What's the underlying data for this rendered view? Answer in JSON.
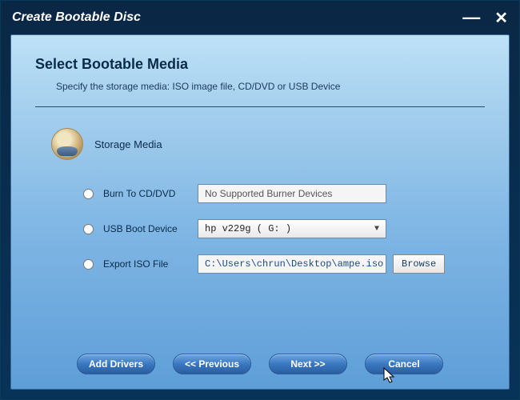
{
  "window": {
    "title": "Create Bootable Disc"
  },
  "heading": "Select Bootable Media",
  "subheading": "Specify the storage media: ISO image file, CD/DVD or USB Device",
  "section_label": "Storage Media",
  "options": {
    "burn": {
      "label": "Burn To CD/DVD",
      "value": "No Supported Burner Devices",
      "selected": false
    },
    "usb": {
      "label": "USB Boot Device",
      "value": "hp    v229g       ( G: )",
      "selected": false
    },
    "iso": {
      "label": "Export ISO File",
      "value": "C:\\Users\\chrun\\Desktop\\ampe.iso",
      "selected": false,
      "browse_label": "Browse"
    }
  },
  "buttons": {
    "add_drivers": "Add Drivers",
    "previous": "<<  Previous",
    "next": "Next  >>",
    "cancel": "Cancel"
  },
  "colors": {
    "titlebar_bg": "#0a2845",
    "panel_top": "#bde1f7",
    "panel_bottom": "#5e9ed8",
    "pill_bg": "#3a78c0"
  }
}
